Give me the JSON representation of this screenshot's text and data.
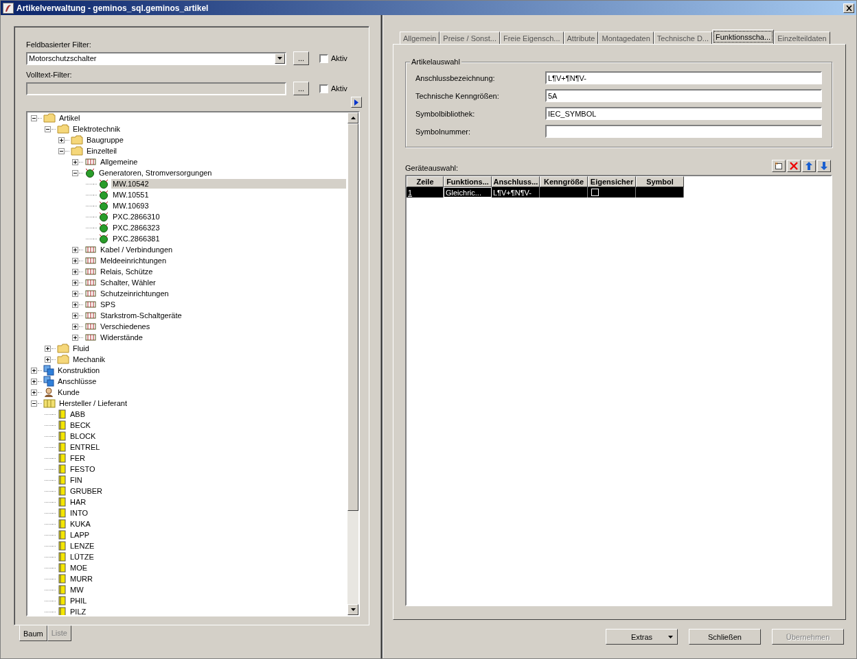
{
  "window": {
    "title": "Artikelverwaltung - geminos_sql.geminos_artikel"
  },
  "filters": [
    {
      "label": "Feldbasierter Filter:",
      "kind": "combo",
      "value": "Motorschutzschalter",
      "enabled": true,
      "button": "...",
      "active_label": "Aktiv",
      "active": false
    },
    {
      "label": "Volltext-Filter:",
      "kind": "text",
      "enabled": false,
      "button": "...",
      "active_label": "Aktiv",
      "active": false
    }
  ],
  "tree": [
    {
      "label": "Artikel",
      "kind": "folder",
      "expanded": true,
      "selected": false,
      "children": [
        {
          "label": "Elektrotechnik",
          "kind": "folder",
          "expanded": true,
          "selected": false,
          "children": [
            {
              "label": "Baugruppe",
              "kind": "folder",
              "expanded": false,
              "selected": false
            },
            {
              "label": "Einzelteil",
              "kind": "folder",
              "expanded": true,
              "selected": false,
              "children": [
                {
                  "label": "Allgemeine",
                  "kind": "category",
                  "expanded": false,
                  "selected": false
                },
                {
                  "label": "Generatoren, Stromversorgungen",
                  "kind": "generator",
                  "expanded": true,
                  "selected": false,
                  "children": [
                    {
                      "label": "MW.10542",
                      "kind": "generator",
                      "selected": true
                    },
                    {
                      "label": "MW.10551",
                      "kind": "generator",
                      "selected": false
                    },
                    {
                      "label": "MW.10693",
                      "kind": "generator",
                      "selected": false
                    },
                    {
                      "label": "PXC.2866310",
                      "kind": "generator",
                      "selected": false
                    },
                    {
                      "label": "PXC.2866323",
                      "kind": "generator",
                      "selected": false
                    },
                    {
                      "label": "PXC.2866381",
                      "kind": "generator",
                      "selected": false
                    }
                  ]
                },
                {
                  "label": "Kabel / Verbindungen",
                  "kind": "category",
                  "expanded": false,
                  "selected": false
                },
                {
                  "label": "Meldeeinrichtungen",
                  "kind": "category",
                  "expanded": false,
                  "selected": false
                },
                {
                  "label": "Relais, Schütze",
                  "kind": "category",
                  "expanded": false,
                  "selected": false
                },
                {
                  "label": "Schalter, Wähler",
                  "kind": "category",
                  "expanded": false,
                  "selected": false
                },
                {
                  "label": "Schutzeinrichtungen",
                  "kind": "category",
                  "expanded": false,
                  "selected": false
                },
                {
                  "label": "SPS",
                  "kind": "category",
                  "expanded": false,
                  "selected": false
                },
                {
                  "label": "Starkstrom-Schaltgeräte",
                  "kind": "category",
                  "expanded": false,
                  "selected": false
                },
                {
                  "label": "Verschiedenes",
                  "kind": "category",
                  "expanded": false,
                  "selected": false
                },
                {
                  "label": "Widerstände",
                  "kind": "category",
                  "expanded": false,
                  "selected": false
                }
              ]
            }
          ]
        },
        {
          "label": "Fluid",
          "kind": "folder",
          "expanded": false,
          "selected": false
        },
        {
          "label": "Mechanik",
          "kind": "folder",
          "expanded": false,
          "selected": false
        }
      ]
    },
    {
      "label": "Konstruktion",
      "kind": "blocks",
      "expanded": false,
      "selected": false
    },
    {
      "label": "Anschlüsse",
      "kind": "blocks",
      "expanded": false,
      "selected": false
    },
    {
      "label": "Kunde",
      "kind": "person",
      "expanded": false,
      "selected": false
    },
    {
      "label": "Hersteller / Lieferant",
      "kind": "binder",
      "expanded": true,
      "selected": false,
      "children": [
        {
          "label": "ABB",
          "kind": "book",
          "selected": false
        },
        {
          "label": "BECK",
          "kind": "book",
          "selected": false
        },
        {
          "label": "BLOCK",
          "kind": "book",
          "selected": false
        },
        {
          "label": "ENTREL",
          "kind": "book",
          "selected": false
        },
        {
          "label": "FER",
          "kind": "book",
          "selected": false
        },
        {
          "label": "FESTO",
          "kind": "book",
          "selected": false
        },
        {
          "label": "FIN",
          "kind": "book",
          "selected": false
        },
        {
          "label": "GRUBER",
          "kind": "book",
          "selected": false
        },
        {
          "label": "HAR",
          "kind": "book",
          "selected": false
        },
        {
          "label": "INTO",
          "kind": "book",
          "selected": false
        },
        {
          "label": "KUKA",
          "kind": "book",
          "selected": false
        },
        {
          "label": "LAPP",
          "kind": "book",
          "selected": false
        },
        {
          "label": "LENZE",
          "kind": "book",
          "selected": false
        },
        {
          "label": "LÜTZE",
          "kind": "book",
          "selected": false
        },
        {
          "label": "MOE",
          "kind": "book",
          "selected": false
        },
        {
          "label": "MURR",
          "kind": "book",
          "selected": false
        },
        {
          "label": "MW",
          "kind": "book",
          "selected": false
        },
        {
          "label": "PHIL",
          "kind": "book",
          "selected": false
        },
        {
          "label": "PILZ",
          "kind": "book",
          "selected": false
        }
      ]
    }
  ],
  "view_tabs": [
    {
      "label": "Baum",
      "selected": true
    },
    {
      "label": "Liste",
      "selected": false
    }
  ],
  "tabs": [
    {
      "label": "Allgemein",
      "selected": false
    },
    {
      "label": "Preise / Sonst...",
      "selected": false
    },
    {
      "label": "Freie Eigensch...",
      "selected": false
    },
    {
      "label": "Attribute",
      "selected": false
    },
    {
      "label": "Montagedaten",
      "selected": false
    },
    {
      "label": "Technische D...",
      "selected": false
    },
    {
      "label": "Funktionsscha...",
      "selected": true
    },
    {
      "label": "Einzelteildaten",
      "selected": false
    }
  ],
  "article_selection": {
    "title": "Artikelauswahl",
    "fields": [
      {
        "label": "Anschlussbezeichnung:",
        "value": "L¶V+¶N¶V-"
      },
      {
        "label": "Technische Kenngrößen:",
        "value": "5A"
      },
      {
        "label": "Symbolbibliothek:",
        "value": "IEC_SYMBOL"
      },
      {
        "label": "Symbolnummer:"
      }
    ]
  },
  "device_selection": {
    "label": "Geräteauswahl:",
    "columns": [
      "Zeile",
      "Funktions...",
      "Anschluss...",
      "Kenngröße",
      "Eigensicher",
      "Symbol"
    ],
    "rows": [
      {
        "selected": true,
        "zeile": "1",
        "funktion": "Gleichric...",
        "anschluss": "L¶V+¶N¶V-",
        "eigensicher": false
      }
    ]
  },
  "buttons": [
    {
      "label": "Extras",
      "kind": "menu",
      "disabled": false
    },
    {
      "label": "Schließen",
      "kind": "plain",
      "disabled": false
    },
    {
      "label": "Übernehmen",
      "kind": "plain",
      "disabled": true
    }
  ]
}
